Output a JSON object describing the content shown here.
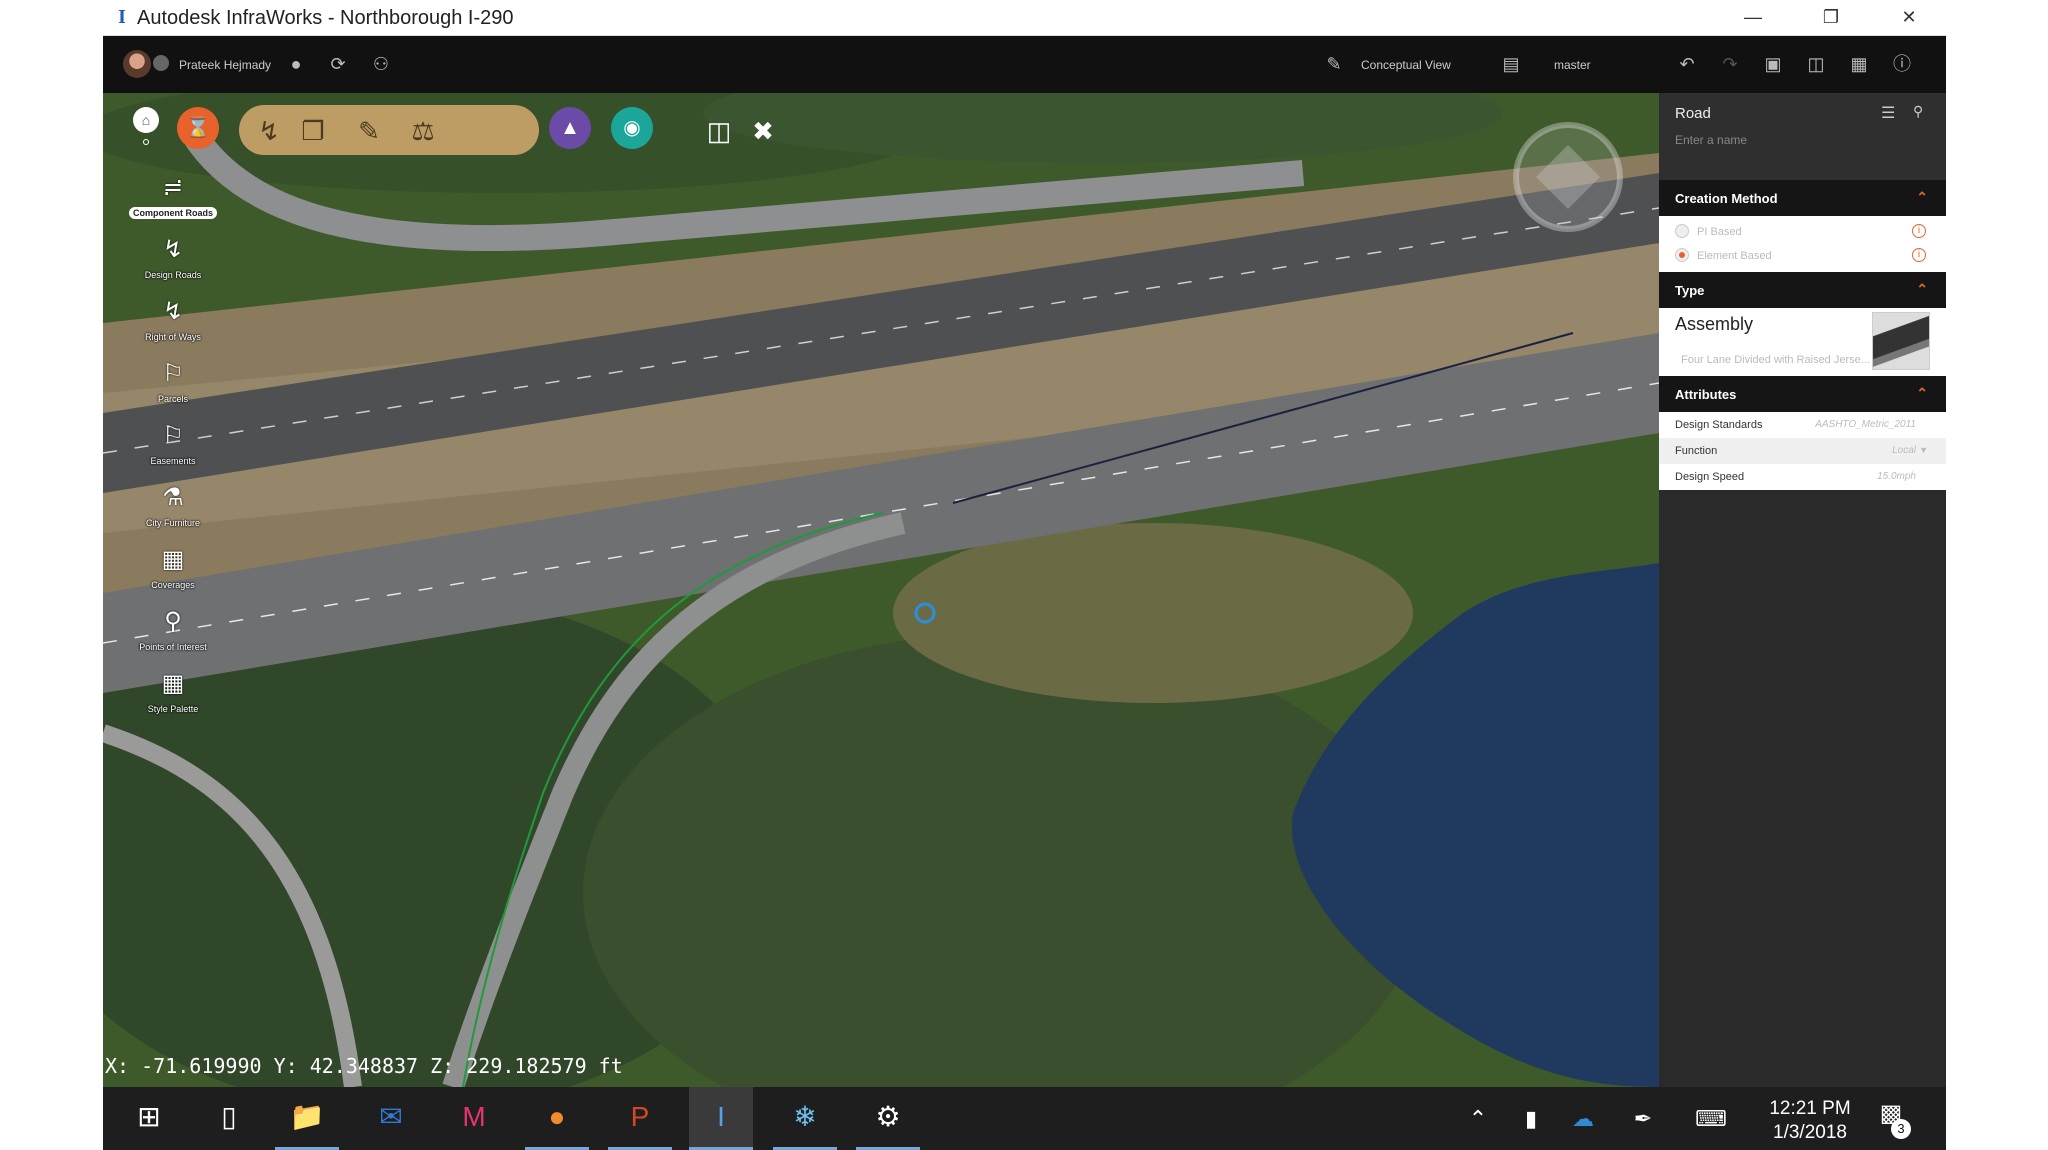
{
  "window": {
    "title": "Autodesk InfraWorks - Northborough I-290",
    "controls": [
      "minimize",
      "restore",
      "close"
    ]
  },
  "topbar": {
    "user_name": "Prateek Hejmady",
    "view_label": "Conceptual View",
    "branch_label": "master"
  },
  "left_tools": [
    {
      "label": "Component Roads",
      "icon": "component-roads-icon"
    },
    {
      "label": "Design Roads",
      "icon": "design-roads-icon"
    },
    {
      "label": "Right of Ways",
      "icon": "right-of-ways-icon"
    },
    {
      "label": "Parcels",
      "icon": "parcels-icon"
    },
    {
      "label": "Easements",
      "icon": "easements-icon"
    },
    {
      "label": "City Furniture",
      "icon": "city-furniture-icon"
    },
    {
      "label": "Coverages",
      "icon": "coverages-icon"
    },
    {
      "label": "Points of Interest",
      "icon": "points-of-interest-icon"
    },
    {
      "label": "Style Palette",
      "icon": "style-palette-icon"
    }
  ],
  "coords": {
    "readout": "X: -71.619990 Y: 42.348837 Z: 229.182579 ft"
  },
  "panel": {
    "title": "Road",
    "name_placeholder": "Enter a name",
    "creation_method": {
      "header": "Creation Method",
      "options": [
        {
          "label": "PI Based",
          "selected": false
        },
        {
          "label": "Element Based",
          "selected": true
        }
      ]
    },
    "type": {
      "header": "Type",
      "name": "Assembly",
      "subtitle": "Four Lane Divided with Raised Jerse..."
    },
    "attributes": {
      "header": "Attributes",
      "rows": [
        {
          "key": "Design Standards",
          "value": "AASHTO_Metric_2011"
        },
        {
          "key": "Function",
          "value": "Local"
        },
        {
          "key": "Design Speed",
          "value": "15.0mph"
        }
      ]
    }
  },
  "taskbar": {
    "time": "12:21 PM",
    "date": "1/3/2018",
    "notification_count": "3"
  },
  "colors": {
    "accent": "#e8632b",
    "tool_orange": "#e8632b",
    "tool_purple": "#6b4aa8",
    "tool_teal": "#1aa79a",
    "section_header": "#151515"
  }
}
